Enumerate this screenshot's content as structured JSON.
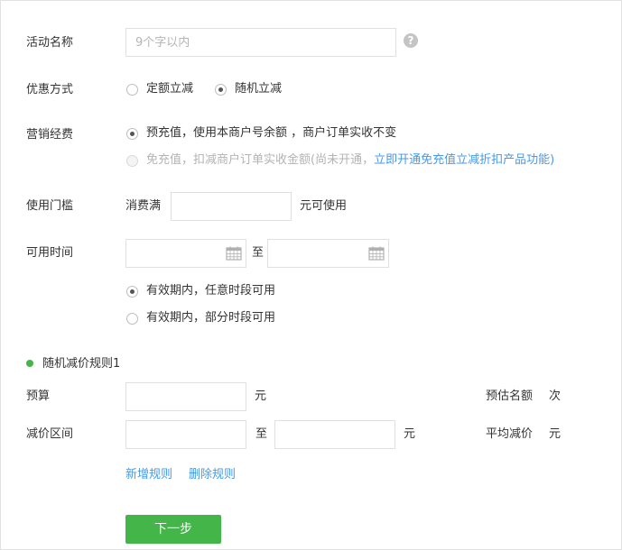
{
  "form": {
    "activity_name": {
      "label": "活动名称",
      "placeholder": "9个字以内",
      "value": ""
    },
    "discount_type": {
      "label": "优惠方式",
      "options": [
        "定额立减",
        "随机立减"
      ],
      "selected": "随机立减"
    },
    "marketing_cost": {
      "label": "营销经费",
      "option1": "预充值，使用本商户号余额 ，商户订单实收不变",
      "option2_prefix": "免充值，扣减商户订单实收金额(尚未开通，",
      "option2_link": "立即开通免充值立减折扣产品功能",
      "option2_suffix": ")",
      "selected": "预充值"
    },
    "threshold": {
      "label": "使用门槛",
      "prefix": "消费满",
      "suffix": "元可使用",
      "value": ""
    },
    "time": {
      "label": "可用时间",
      "separator": "至",
      "options": [
        "有效期内，任意时段可用",
        "有效期内，部分时段可用"
      ],
      "selected": "有效期内，任意时段可用"
    },
    "rule": {
      "title": "随机减价规则1",
      "budget_label": "预算",
      "budget_unit": "元",
      "range_label": "减价区间",
      "range_separator": "至",
      "range_unit": "元",
      "estimate_label": "预估名额",
      "estimate_unit": "次",
      "average_label": "平均减价",
      "average_unit": "元"
    },
    "rule_actions": {
      "add": "新增规则",
      "delete": "删除规则"
    },
    "next_button": "下一步"
  },
  "colors": {
    "accent_green": "#44b549",
    "link_blue": "#459ae9",
    "border": "#e0e0e0"
  },
  "icons": [
    "help-icon",
    "calendar-icon",
    "radio-icon",
    "bullet-dot-icon"
  ]
}
